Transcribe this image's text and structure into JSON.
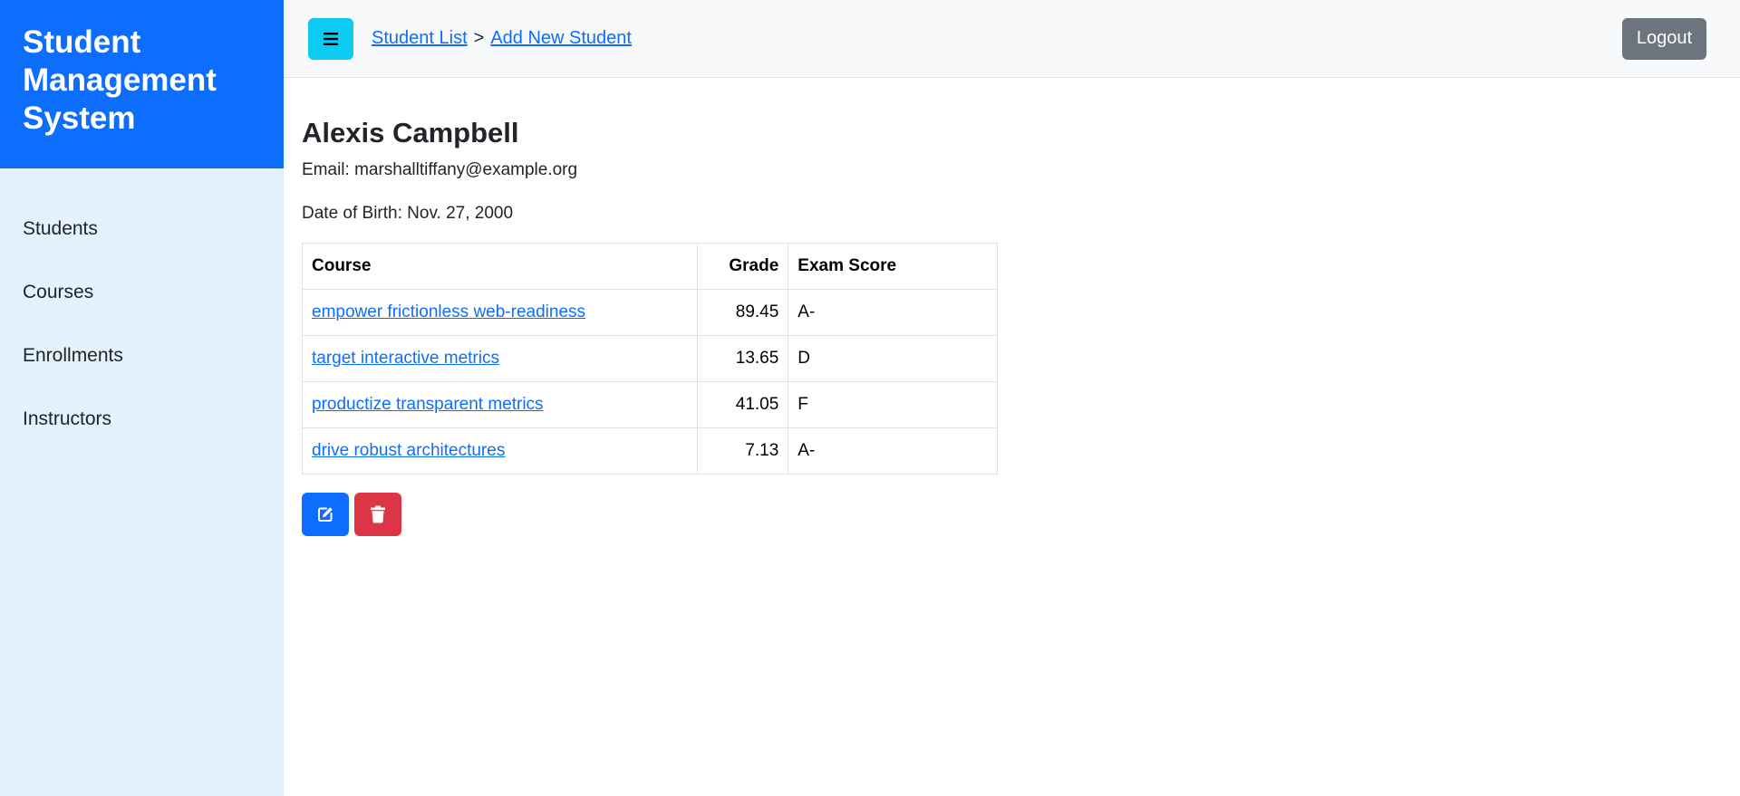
{
  "sidebar": {
    "brand": "Student Management System",
    "items": [
      {
        "label": "Students"
      },
      {
        "label": "Courses"
      },
      {
        "label": "Enrollments"
      },
      {
        "label": "Instructors"
      }
    ]
  },
  "topbar": {
    "menu_icon": "hamburger-icon",
    "breadcrumb": {
      "root": "Student List",
      "separator": ">",
      "current": "Add New Student"
    },
    "logout_label": "Logout"
  },
  "student": {
    "name": "Alexis Campbell",
    "email_line": "Email: marshalltiffany@example.org",
    "dob_line": "Date of Birth: Nov. 27, 2000"
  },
  "table": {
    "headers": {
      "course": "Course",
      "grade": "Grade",
      "exam_score": "Exam Score"
    },
    "rows": [
      {
        "course": "empower frictionless web-readiness",
        "grade": "89.45",
        "exam_score": "A-"
      },
      {
        "course": "target interactive metrics",
        "grade": "13.65",
        "exam_score": "D"
      },
      {
        "course": "productize transparent metrics",
        "grade": "41.05",
        "exam_score": "F"
      },
      {
        "course": "drive robust architectures",
        "grade": "7.13",
        "exam_score": "A-"
      }
    ]
  },
  "actions": {
    "edit_icon": "edit-icon",
    "delete_icon": "trash-icon"
  },
  "colors": {
    "brand": "#0d6efd",
    "sidebar_bg": "#e3f2fd",
    "menu_button": "#0dcaf0",
    "logout_button": "#6c757d",
    "delete_button": "#dc3545"
  }
}
